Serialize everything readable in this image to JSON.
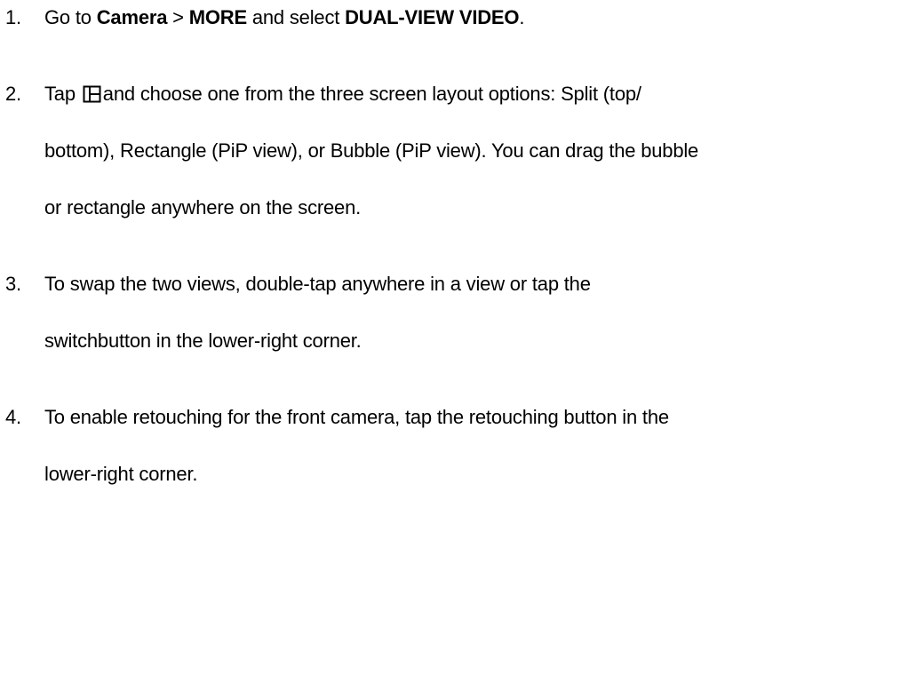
{
  "steps": [
    {
      "number": "1.",
      "lines": [
        {
          "part1": "Go to ",
          "camera": "Camera",
          "sep": " > ",
          "more": "MORE",
          "part2": " and select ",
          "dual": "DUAL-VIEW VIDEO",
          "end": "."
        }
      ]
    },
    {
      "number": "2.",
      "icon": "split-layout-icon",
      "lines": [
        {
          "before_icon": "Tap ",
          "after_icon": "and choose one from the three screen layout options: Split (top/"
        },
        {
          "text": "bottom), Rectangle (PiP view), or Bubble (PiP view). You can drag the bubble"
        },
        {
          "text": "or rectangle anywhere on the screen."
        }
      ]
    },
    {
      "number": "3.",
      "lines": [
        {
          "text": "To swap the two views, double-tap anywhere in a view or tap the"
        },
        {
          "text": "switchbutton in the lower-right corner."
        }
      ]
    },
    {
      "number": "4.",
      "lines": [
        {
          "text": "To enable retouching for the front camera, tap the retouching button in the"
        },
        {
          "text": "lower-right corner."
        }
      ]
    }
  ]
}
